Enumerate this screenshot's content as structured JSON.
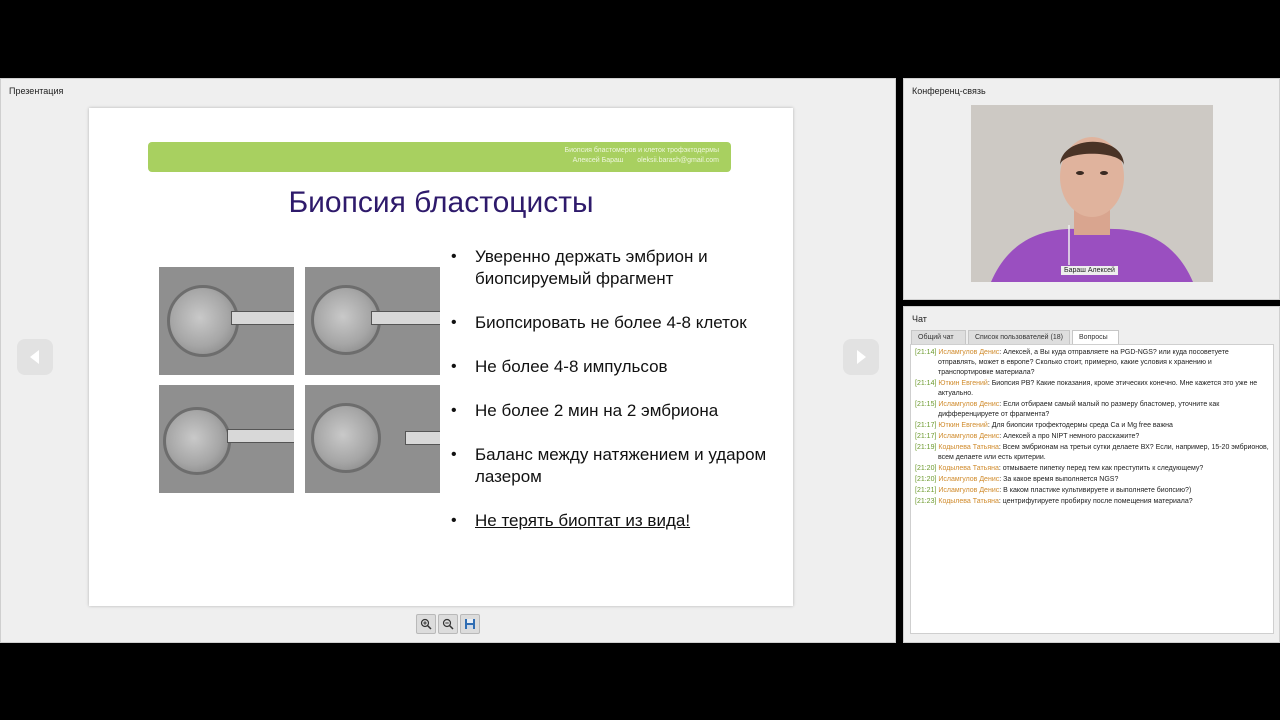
{
  "presentation": {
    "title": "Презентация",
    "banner": {
      "line1": "Биопсия бластомеров и клеток трофэктодермы",
      "author": "Алексей Бараш",
      "email": "oleksii.barash@gmail.com"
    },
    "slide_title": "Биопсия бластоцисты",
    "bullets": [
      "Уверенно держать эмбрион и биопсируемый фрагмент",
      "Биопсировать не более 4-8 клеток",
      "Не более 4-8 импульсов",
      "Не более 2 мин на 2 эмбриона",
      "Баланс между натяжением и ударом лазером",
      "Не терять биоптат из вида!"
    ],
    "tools": [
      "zoom-in-icon",
      "zoom-out-icon",
      "save-icon"
    ]
  },
  "conference": {
    "title": "Конференц-связь",
    "participant_name": "Бараш Алексей"
  },
  "chat": {
    "title": "Чат",
    "tabs": [
      "Общий чат",
      "Список пользователей (18)",
      "Вопросы"
    ],
    "active_tab": "Вопросы",
    "messages": [
      {
        "time": "[21:14]",
        "author": "Исламгулов Денис",
        "text": "Алексей, а Вы куда отправляете на PGD-NGS? или куда посоветуете отправлять, может в европе? Сколько стоит, примерно, какие условия к хранению и транспортировке материала?"
      },
      {
        "time": "[21:14]",
        "author": "Юткин Евгений",
        "text": "Биопсия PB? Какие показания, кроме этических конечно. Мне кажется это уже не актуально."
      },
      {
        "time": "[21:15]",
        "author": "Исламгулов Денис",
        "text": "Если отбираем самый малый по размеру бластомер, уточните как дифференцируете от фрагмента?"
      },
      {
        "time": "[21:17]",
        "author": "Юткин Евгений",
        "text": "Для биопсии трофектодермы среда Ca и Mg free важна"
      },
      {
        "time": "[21:17]",
        "author": "Исламгулов Денис",
        "text": "Алексей а про NIPT немного расскажите?"
      },
      {
        "time": "[21:19]",
        "author": "Кодылева Татьяна",
        "text": "Всем эмбрионам на третьи сутки делаете ВХ? Если, например, 15-20 эмбрионов, всем делаете или есть критерии."
      },
      {
        "time": "[21:20]",
        "author": "Кодылева Татьяна",
        "text": "отмываете пипетку перед тем как преступить к следующему?"
      },
      {
        "time": "[21:20]",
        "author": "Исламгулов Денис",
        "text": "За какое время выполняется NGS?"
      },
      {
        "time": "[21:21]",
        "author": "Исламгулов Денис",
        "text": "В каком пластике культивируете и выполняете биопсию?)"
      },
      {
        "time": "[21:23]",
        "author": "Кодылева Татьяна",
        "text": "центрифугируете пробирку после помещения материала?"
      }
    ]
  }
}
